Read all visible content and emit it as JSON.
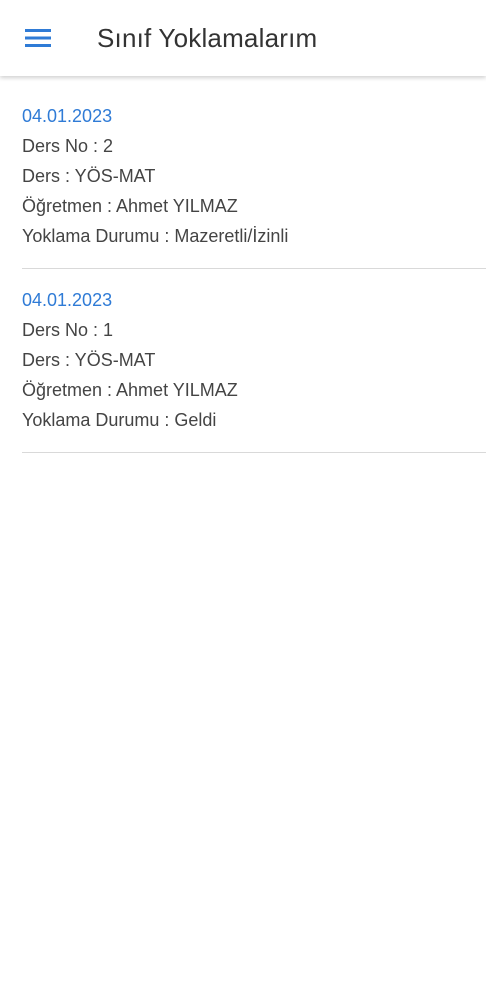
{
  "header": {
    "title": "Sınıf Yoklamalarım",
    "menu_icon": "hamburger-menu-icon"
  },
  "colors": {
    "accent": "#2f7bd6",
    "text": "#444444",
    "divider": "#d9d9d9"
  },
  "records": [
    {
      "date": "04.01.2023",
      "lesson_no": "Ders No : 2",
      "course": "Ders : YÖS-MAT",
      "teacher": "Öğretmen : Ahmet YILMAZ",
      "status": "Yoklama Durumu : Mazeretli/İzinli"
    },
    {
      "date": "04.01.2023",
      "lesson_no": "Ders No : 1",
      "course": "Ders : YÖS-MAT",
      "teacher": "Öğretmen : Ahmet YILMAZ",
      "status": "Yoklama Durumu : Geldi"
    }
  ]
}
